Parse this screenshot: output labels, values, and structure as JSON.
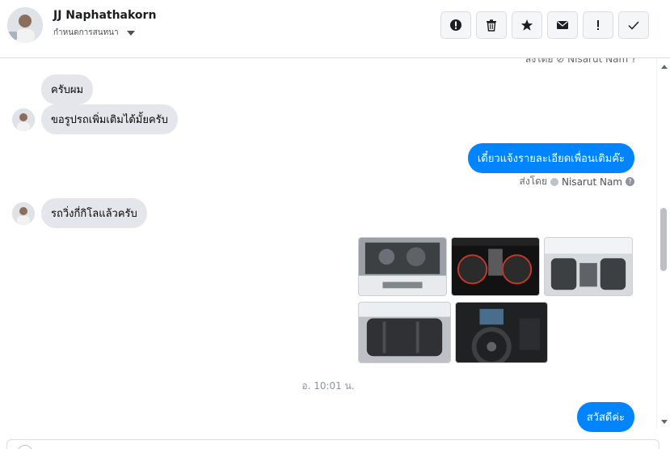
{
  "header": {
    "contact_name": "JJ Naphathakorn",
    "assign_label": "กำหนดการสนทนา",
    "actions": [
      {
        "name": "spam-icon",
        "label": "!"
      },
      {
        "name": "trash-icon",
        "label": ""
      },
      {
        "name": "star-icon",
        "label": ""
      },
      {
        "name": "envelope-icon",
        "label": ""
      },
      {
        "name": "follow-up-icon",
        "label": "!"
      },
      {
        "name": "checkmark-icon",
        "label": ""
      }
    ]
  },
  "thread": {
    "truncated_sender": "ส่งโดย ⊘ Nisarut Nam ?",
    "messages": [
      {
        "direction": "in",
        "text": "ครับผม"
      },
      {
        "direction": "in",
        "text": "ขอรูปรถเพิ่มเติมได้มั้ยครับ"
      },
      {
        "direction": "out",
        "text": "เดี๋ยวแจ้งรายละเอียดเพื่อนเติมค๊ะ"
      },
      {
        "direction": "in",
        "text": "รถวิ่งกี่กิโลแล้วครับ"
      },
      {
        "direction": "out",
        "text": "สวัสดีค่ะ"
      }
    ],
    "sent_by_prefix": "ส่งโดย",
    "sent_by_name": "Nisarut Nam",
    "timestamp": "อ. 10:01 น.",
    "photos": [
      {
        "name": "engine-photo"
      },
      {
        "name": "gauge-photo"
      },
      {
        "name": "cabin-photo"
      },
      {
        "name": "rear-seat-photo"
      },
      {
        "name": "steering-photo"
      }
    ]
  },
  "colors": {
    "outgoing_bubble": "#0084ff",
    "incoming_bubble": "#e4e6eb"
  }
}
